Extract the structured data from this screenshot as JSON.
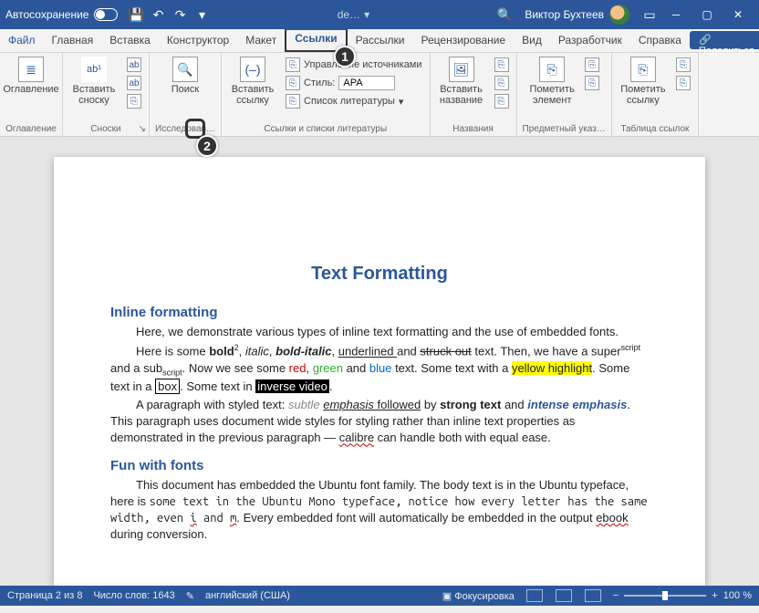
{
  "titlebar": {
    "autosave": "Автосохранение",
    "doc": "de…",
    "user": "Виктор Бухтеев",
    "dropdown": "▾"
  },
  "tabs": {
    "file": "Файл",
    "home": "Главная",
    "insert": "Вставка",
    "design": "Конструктор",
    "layout": "Макет",
    "references": "Ссылки",
    "mailings": "Рассылки",
    "review": "Рецензирование",
    "view": "Вид",
    "developer": "Разработчик",
    "help": "Справка",
    "share": "Поделиться"
  },
  "ribbon": {
    "toc": {
      "btn": "Оглавление",
      "group": "Оглавление"
    },
    "footnotes": {
      "insert": "Вставить сноску",
      "ab": "ab¹",
      "group": "Сноски"
    },
    "research": {
      "search": "Поиск",
      "group": "Исследован…"
    },
    "citations": {
      "insert": "Вставить ссылку",
      "manage": "Управление источниками",
      "style_label": "Стиль:",
      "style_value": "APA",
      "biblio": "Список литературы",
      "group": "Ссылки и списки литературы"
    },
    "captions": {
      "insert": "Вставить название",
      "group": "Названия"
    },
    "index": {
      "mark": "Пометить элемент",
      "group": "Предметный указ…"
    },
    "authorities": {
      "mark": "Пометить ссылку",
      "group": "Таблица ссылок"
    }
  },
  "doc": {
    "title": "Text Formatting",
    "h_inline": "Inline formatting",
    "p1a": "Here, we demonstrate various types of inline text formatting and the use of embedded fonts.",
    "p2": {
      "a": "Here is some ",
      "bold": "bold",
      "sup2": "2",
      "b": ", ",
      "italic": "italic",
      "c": ", ",
      "bi": "bold-italic",
      "d": ", ",
      "under": "underlined ",
      "e": "and ",
      "strike": "struck out",
      "f": "  text. Then, we have a super",
      "sup": "script",
      "g": " and a sub",
      "sub": "script",
      "h": ". Now we see some ",
      "red": "red",
      "i": ", ",
      "green": "green",
      "j": " and ",
      "blue": "blue",
      "k": " text. Some text with a ",
      "yh": "yellow highlight",
      "l": ". Some text in a ",
      "box": "box",
      "m": ". Some text in ",
      "inv": "inverse video",
      "n": "."
    },
    "p3": {
      "a": "A paragraph with styled text: ",
      "subtle": "subtle ",
      "emph": "emphasis ",
      "b": " followed",
      "c": " by ",
      "strong": "strong text",
      "d": " and ",
      "intense": "intense emphasis",
      "e": ". This paragraph uses document wide styles for styling rather than inline text properties as demonstrated in the previous paragraph — ",
      "calibre": "calibre",
      "f": " can handle both with equal ease."
    },
    "h_fonts": "Fun with fonts",
    "p4": {
      "a": "This document has embedded the Ubuntu font family. The body text is in the Ubuntu typeface, here is ",
      "mono": "some text in the Ubuntu Mono typeface, notice how every letter has the same width, even ",
      "i": "i",
      "and": " and ",
      "m": "m",
      "b": ". Every embedded font will automatically be embedded in the output ",
      "ebook": "ebook",
      "c": " during conversion."
    }
  },
  "status": {
    "page": "Страница 2 из 8",
    "words": "Число слов: 1643",
    "lang": "английский (США)",
    "focus": "Фокусировка",
    "zoom": "100 %"
  },
  "callouts": {
    "one": "1",
    "two": "2"
  }
}
